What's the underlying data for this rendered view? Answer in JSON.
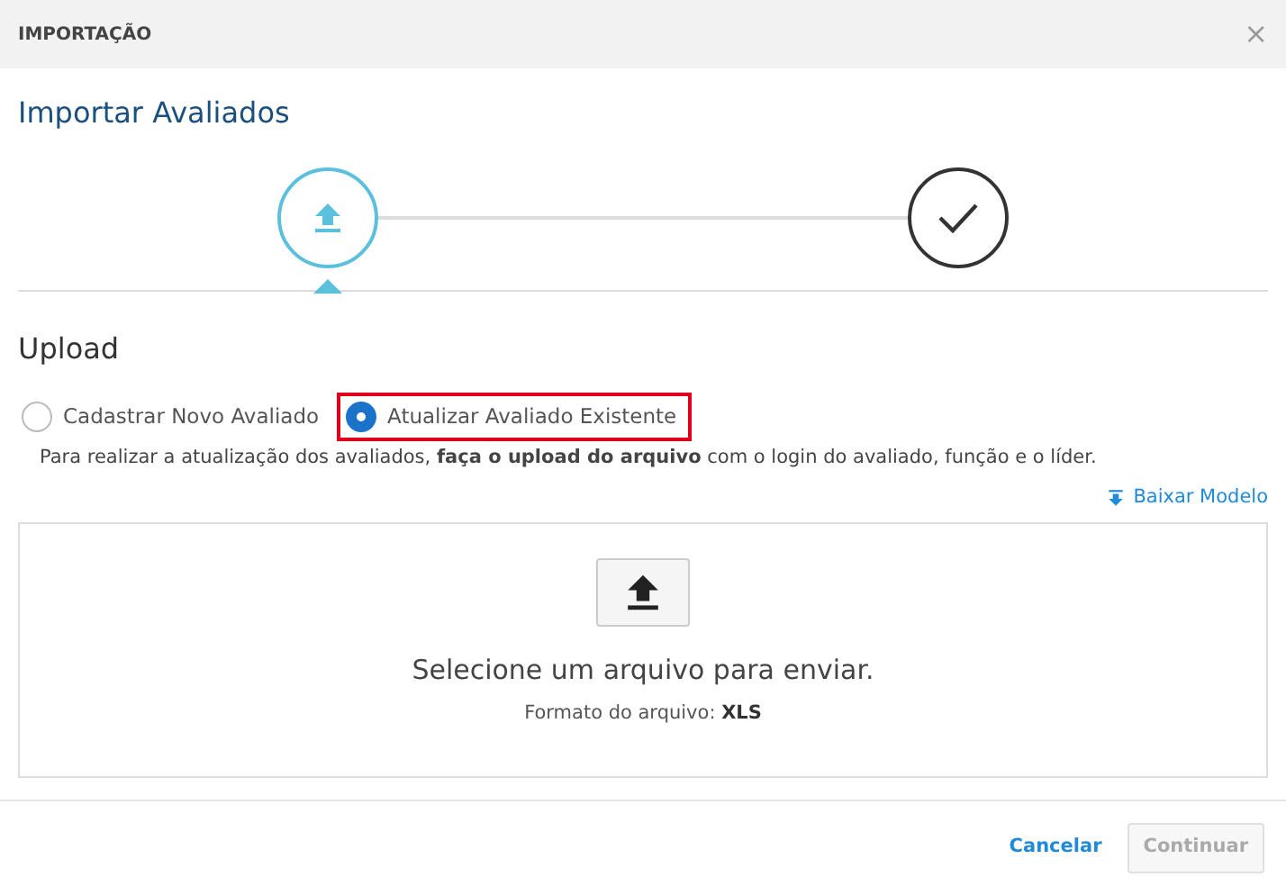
{
  "dialog": {
    "title": "IMPORTAÇÃO",
    "close": "×"
  },
  "heading": "Importar Avaliados",
  "steps": [
    {
      "kind": "upload",
      "selected": true
    },
    {
      "kind": "done",
      "selected": false
    }
  ],
  "section": {
    "title": "Upload"
  },
  "options": [
    {
      "label": "Cadastrar Novo Avaliado",
      "selected": false,
      "highlighted": false
    },
    {
      "label": "Atualizar Avaliado Existente",
      "selected": true,
      "highlighted": true
    }
  ],
  "description": "Para realizar a atualização dos avaliados, **faça o upload do arquivo** com o login do avaliado, função e o líder.",
  "download_link": "Baixar Modelo",
  "dropzone": {
    "title": "Selecione um arquivo para enviar.",
    "format_label": "Formato do arquivo:",
    "format": "XLS"
  },
  "buttons": [
    {
      "label": "Cancelar",
      "kind": "link",
      "disabled": false
    },
    {
      "label": "Continuar",
      "kind": "primary",
      "disabled": true
    }
  ]
}
